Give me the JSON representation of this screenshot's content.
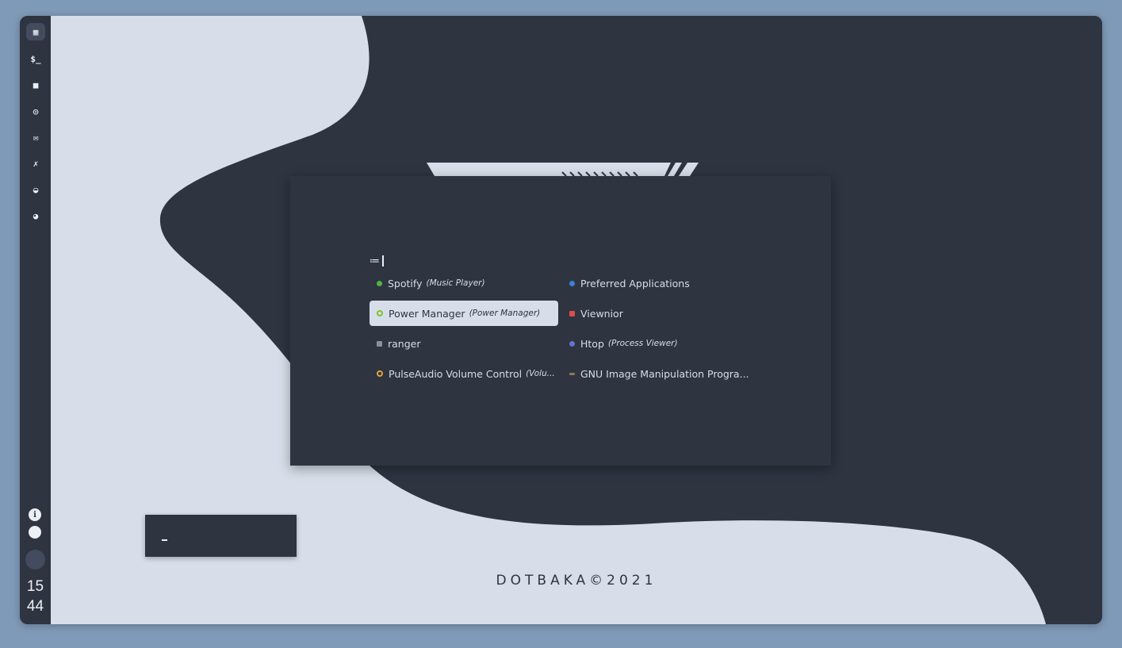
{
  "sidebar": {
    "icons": [
      {
        "name": "dashboard-icon",
        "glyph": "▦"
      },
      {
        "name": "terminal-icon",
        "glyph": "$_"
      },
      {
        "name": "folder-icon",
        "glyph": "■"
      },
      {
        "name": "help-icon",
        "glyph": "◎"
      },
      {
        "name": "mail-icon",
        "glyph": "✉"
      },
      {
        "name": "pin-icon",
        "glyph": "✗"
      },
      {
        "name": "github-icon",
        "glyph": "◒"
      },
      {
        "name": "reddit-icon",
        "glyph": "◕"
      }
    ],
    "bottom": {
      "info_glyph": "i",
      "clock_hour": "15",
      "clock_minute": "44"
    }
  },
  "launcher": {
    "prompt_icon": "≔",
    "entries": [
      {
        "label": "Spotify",
        "sub": "(Music Player)",
        "color": "#52b348"
      },
      {
        "label": "Preferred Applications",
        "sub": "",
        "color": "#3d7fd6"
      },
      {
        "label": "Power Manager",
        "sub": "(Power Manager)",
        "color": "#7cc42a"
      },
      {
        "label": "Viewnior",
        "sub": "",
        "color": "#e04b4b"
      },
      {
        "label": "ranger",
        "sub": "",
        "color": "#8a8f99"
      },
      {
        "label": "Htop",
        "sub": "(Process Viewer)",
        "color": "#6b6fd6"
      },
      {
        "label": "PulseAudio Volume Control",
        "sub": "(Volu...",
        "color": "#e3a33a"
      },
      {
        "label": "GNU Image Manipulation Progra...",
        "sub": "",
        "color": "#8a7a5a"
      }
    ]
  },
  "footer": {
    "text": "DOTBAKA©2021"
  },
  "colors": {
    "bg": "#2e3440",
    "wave": "#d8dee9",
    "accent": "#eceff4"
  }
}
